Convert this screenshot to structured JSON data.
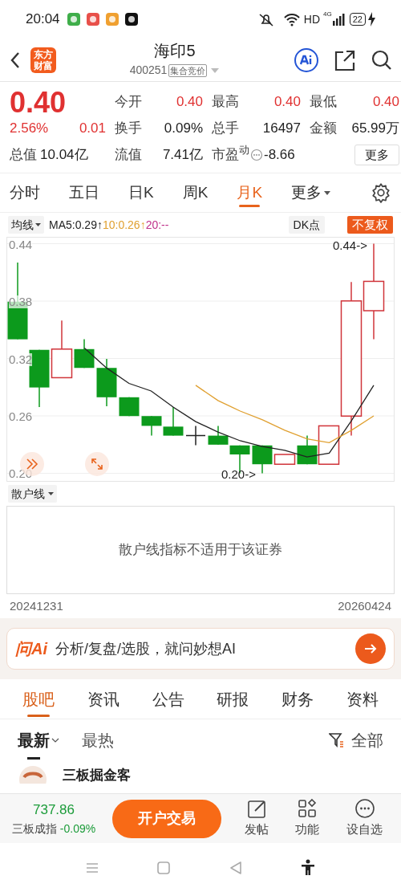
{
  "status_bar": {
    "time": "20:04",
    "hd": "HD",
    "network": "4G",
    "battery": "22"
  },
  "header": {
    "logo": "东方财富",
    "title": "海印5",
    "code": "400251",
    "badge": "集合竞价"
  },
  "quote": {
    "price": "0.40",
    "change_pct": "2.56%",
    "change": "0.01",
    "fields": [
      {
        "label": "今开",
        "value": "0.40",
        "rising": true
      },
      {
        "label": "最高",
        "value": "0.40",
        "rising": true
      },
      {
        "label": "最低",
        "value": "0.40",
        "rising": true
      },
      {
        "label": "换手",
        "value": "0.09%",
        "rising": false
      },
      {
        "label": "总手",
        "value": "16497",
        "rising": false
      },
      {
        "label": "金额",
        "value": "65.99万",
        "rising": false
      }
    ],
    "total_value": {
      "label": "总值",
      "value": "10.04亿"
    },
    "float_value": {
      "label": "流值",
      "value": "7.41亿"
    },
    "pe": {
      "label": "市盈$^{动}$",
      "value": "-8.66"
    },
    "more_button": "更多"
  },
  "chart_tabs": [
    {
      "label": "分时",
      "selected": false,
      "has_menu": false
    },
    {
      "label": "五日",
      "selected": false,
      "has_menu": false
    },
    {
      "label": "日K",
      "selected": false,
      "has_menu": false
    },
    {
      "label": "周K",
      "selected": false,
      "has_menu": false
    },
    {
      "label": "月K",
      "selected": true,
      "has_menu": false
    },
    {
      "label": "更多",
      "selected": false,
      "has_menu": true
    }
  ],
  "indicator_bar": {
    "selector": "均线",
    "averages": [
      {
        "text": "MA5:0.29↑",
        "color": "#222222"
      },
      {
        "text": "10:0.26↑",
        "color": "#e0a030"
      },
      {
        "text": "20:--",
        "color": "#c0308a"
      }
    ],
    "dk_button": "DK点",
    "adjust_badge": "不复权"
  },
  "kline": {
    "high_marker": "0.44->",
    "low_marker": "0.20->",
    "chart_data": {
      "type": "line",
      "grid": true,
      "ylim": [
        0.192,
        0.448
      ],
      "yticks": [
        {
          "value": 0.44,
          "label": "0.44"
        },
        {
          "value": 0.38,
          "label": "0.38"
        },
        {
          "value": 0.32,
          "label": "0.32"
        },
        {
          "value": 0.26,
          "label": "0.26"
        },
        {
          "value": 0.2,
          "label": "0.20"
        }
      ],
      "series": [
        {
          "color": "#222222",
          "values": [
            null,
            null,
            null,
            0.331,
            0.31,
            0.294,
            0.286,
            0.269,
            0.254,
            0.243,
            0.234,
            0.228,
            0.224,
            0.217,
            0.221,
            0.255,
            0.292
          ]
        },
        {
          "color": "#e0a030",
          "values": [
            null,
            null,
            null,
            null,
            null,
            null,
            null,
            null,
            0.292,
            0.276,
            0.265,
            0.256,
            0.245,
            0.236,
            0.232,
            0.245,
            0.26
          ]
        }
      ]
    }
  },
  "sub_indicator": {
    "selector": "散户线",
    "message": "散户线指标不适用于该证券"
  },
  "date_range": {
    "start": "20241231",
    "end": "20260424"
  },
  "ai_bar": {
    "logo": "问Ai",
    "prompt": "分析/复盘/选股，就问妙想AI"
  },
  "section_tabs": [
    {
      "label": "股吧",
      "selected": true
    },
    {
      "label": "资讯",
      "selected": false
    },
    {
      "label": "公告",
      "selected": false
    },
    {
      "label": "研报",
      "selected": false
    },
    {
      "label": "财务",
      "selected": false
    },
    {
      "label": "资料",
      "selected": false
    }
  ],
  "feed_tabs": [
    {
      "label": "最新",
      "selected": true,
      "has_menu": true
    },
    {
      "label": "最热",
      "selected": false,
      "has_menu": false
    }
  ],
  "filter": "全部",
  "post": {
    "author": "三板掘金客"
  },
  "bottom_bar": {
    "index_value": "737.86",
    "index_name": "三板成指",
    "index_change": "-0.09%",
    "trade_button": "开户交易",
    "actions": [
      "发帖",
      "功能",
      "设自选"
    ]
  }
}
